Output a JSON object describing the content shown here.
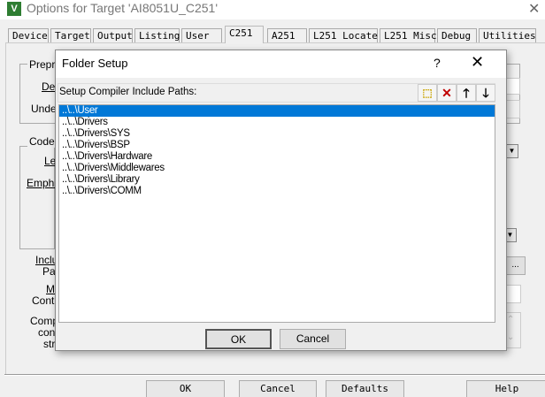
{
  "window": {
    "title": "Options for Target 'AI8051U_C251'",
    "close": "✕",
    "icon": "V"
  },
  "tabs": [
    "Device",
    "Target",
    "Output",
    "Listing",
    "User",
    "C251",
    "A251",
    "L251 Locate",
    "L251 Misc",
    "Debug",
    "Utilities"
  ],
  "active_tab": "C251",
  "background_labels": {
    "preprocessor": "Prepro",
    "define": "Def",
    "undefine": "Undef",
    "code": "Code",
    "level": "Le",
    "emphasis": "Empha",
    "include": "Inclu",
    "paths": "Pat",
    "misc": "M",
    "controls": "Contr",
    "compiler": "Comp",
    "control": "con",
    "string": "stri",
    "browse": "..."
  },
  "footer": {
    "ok": "OK",
    "cancel": "Cancel",
    "defaults": "Defaults",
    "help": "Help"
  },
  "dialog": {
    "title": "Folder Setup",
    "help": "?",
    "close": "✕",
    "label": "Setup Compiler Include Paths:",
    "toolbar": {
      "new": "⬚",
      "delete": "✕",
      "up": "🡑",
      "down": "🡓"
    },
    "paths": [
      "..\\..\\User",
      "..\\..\\Drivers",
      "..\\..\\Drivers\\SYS",
      "..\\..\\Drivers\\BSP",
      "..\\..\\Drivers\\Hardware",
      "..\\..\\Drivers\\Middlewares",
      "..\\..\\Drivers\\Library",
      "..\\..\\Drivers\\COMM"
    ],
    "selected_index": 0,
    "ok": "OK",
    "cancel": "Cancel"
  },
  "colors": {
    "selection": "#0078d7",
    "delete": "#c00000"
  }
}
